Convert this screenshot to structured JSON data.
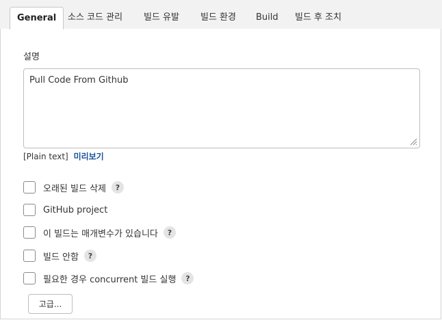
{
  "tabs": [
    {
      "label": "General",
      "active": true
    },
    {
      "label": "소스 코드 관리",
      "active": false
    },
    {
      "label": "빌드 유발",
      "active": false
    },
    {
      "label": "빌드 환경",
      "active": false
    },
    {
      "label": "Build",
      "active": false
    },
    {
      "label": "빌드 후 조치",
      "active": false
    }
  ],
  "description": {
    "label": "설명",
    "value": "Pull Code From Github",
    "format_note": "[Plain text]",
    "preview_link": "미리보기"
  },
  "options": [
    {
      "label": "오래된 빌드 삭제",
      "checked": false,
      "help": "?"
    },
    {
      "label": "GitHub project",
      "checked": false,
      "help": ""
    },
    {
      "label": "이 빌드는 매개변수가 있습니다",
      "checked": false,
      "help": "?"
    },
    {
      "label": "빌드 안함",
      "checked": false,
      "help": "?"
    },
    {
      "label": "필요한 경우 concurrent 빌드 실행",
      "checked": false,
      "help": "?"
    }
  ],
  "advanced_button": "고급...",
  "colors": {
    "tab_bar_bg": "#f2f2f2",
    "link": "#1b4f9c",
    "help_bg": "#e4e4e4",
    "border": "#bdbdbd"
  }
}
